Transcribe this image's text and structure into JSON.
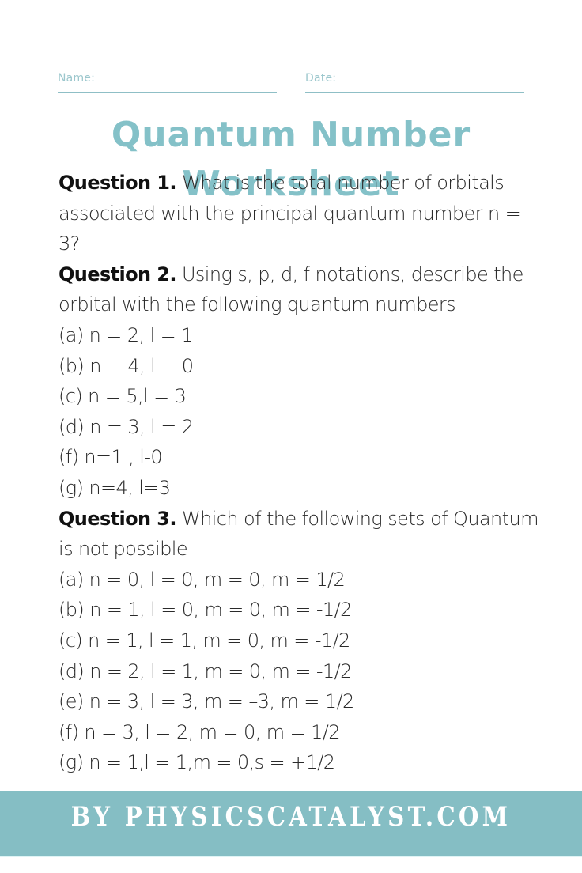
{
  "header": {
    "name_label": "Name:",
    "date_label": "Date:"
  },
  "title": "Quantum Number Worksheet",
  "questions": [
    {
      "label": "Question 1.",
      "text": "What is the total number of orbitals associated with the principal quantum number n = 3?",
      "options": []
    },
    {
      "label": "Question 2.",
      "text": "Using s, p, d, f notations, describe the orbital with the following quantum numbers",
      "options": [
        "(a) n = 2, l = 1",
        "(b) n = 4, l = 0",
        "(c) n = 5,l = 3",
        "(d) n = 3, l = 2",
        "(f) n=1 , l-0",
        "(g) n=4, l=3"
      ]
    },
    {
      "label": "Question 3.",
      "text": "Which of the following sets of Quantum is not possible",
      "options": [
        "(a) n = 0, l = 0, m = 0, m = 1/2",
        "(b) n = 1, l = 0, m = 0, m = -1/2",
        "(c) n = 1, l = 1, m = 0, m = -1/2",
        "(d) n = 2, l = 1, m = 0, m = -1/2",
        "(e) n = 3, l = 3, m = –3, m = 1/2",
        "(f) n = 3, l = 2, m = 0, m = 1/2",
        "(g) n = 1,l = 1,m = 0,s = +1/2"
      ]
    }
  ],
  "footer": {
    "banner_text": "BY PHYSICSCATALYST.COM"
  },
  "colors": {
    "accent": "#84c1c8",
    "banner": "#85bec4",
    "field_label": "#9cc7cd",
    "text": "#222222"
  }
}
